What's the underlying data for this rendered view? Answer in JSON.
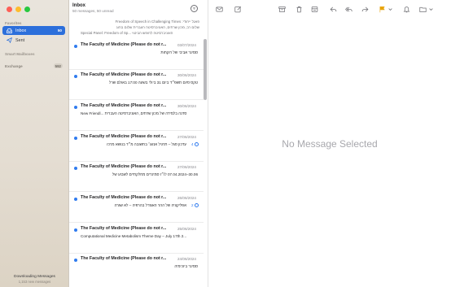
{
  "sidebar": {
    "favorites_label": "Favorites",
    "items": [
      {
        "label": "Inbox",
        "count": "50",
        "icon": "inbox-tray-icon"
      },
      {
        "label": "Sent",
        "icon": "paper-plane-icon"
      }
    ],
    "smart_mailboxes_label": "Smart Mailboxes",
    "exchange": {
      "label": "Exchange",
      "count": "592"
    },
    "footer": {
      "status": "Downloading Messages",
      "detail": "1,153 new messages"
    }
  },
  "list": {
    "title": "Inbox",
    "subtitle": "50 messages, 50 unread",
    "top_partial": {
      "line1": "פאנל ייחודי: Freedom of Speech in Challenging Times",
      "line2": "שלום רב, מכון שרתים, האוניברסיטה העברית שלום בחוג",
      "line3": "Special Panel: Freedom of Sp... האוניברסיטה לחופש הביטוי"
    },
    "messages": [
      {
        "from": "The Faculty of Medicine (Please do not r...",
        "date": "03/07/2024",
        "subject": "סמינר אביבי של רוקחות",
        "rtl": true
      },
      {
        "from": "The Faculty of Medicine (Please do not r...",
        "date": "30/06/2024",
        "subject": "טקס סיום תשפ״ד ביום 31 ביולי בשעה 17:00 באולם שרל",
        "rtl": true
      },
      {
        "from": "The Faculty of Medicine (Please do not r...",
        "date": "30/06/2024",
        "subject": "New Friendl... סדנה בלמידה של מכון שרתים, האוניברסיטה העברית",
        "rtl": false
      },
      {
        "from": "The Faculty of Medicine (Please do not r...",
        "date": "27/06/2024",
        "subject": "עדכון סגל – תרגיל אנזוג׳ בתשובה מ״ד בנושא מרכז",
        "rtl": true,
        "badge": "4"
      },
      {
        "from": "The Faculty of Medicine (Please do not r...",
        "date": "27/06/2024",
        "subject": "30.06–07.04.2024 לו״ז סמינרים מחלקתיים לשבוע של",
        "rtl": true
      },
      {
        "from": "The Faculty of Medicine (Please do not r...",
        "date": "26/06/2024",
        "subject": "אפליקציה של ההר האגודל בהרפיה – לא שגרה",
        "rtl": true,
        "badge": "2"
      },
      {
        "from": "The Faculty of Medicine (Please do not r...",
        "date": "25/06/2024",
        "subject": "Computational Medicine Metabolism Theme Day – July 17th 2...",
        "rtl": false
      },
      {
        "from": "The Faculty of Medicine (Please do not r...",
        "date": "24/06/2024",
        "subject": "סמינר ביוכימיה",
        "rtl": true
      }
    ]
  },
  "toolbar": {
    "icons": [
      "envelope-icon",
      "compose-icon",
      "archive-icon",
      "trash-icon",
      "junk-icon",
      "reply-icon",
      "reply-all-icon",
      "forward-icon",
      "flag-icon",
      "bell-icon",
      "move-to-folder-icon"
    ]
  },
  "detail": {
    "empty_text": "No Message Selected"
  }
}
